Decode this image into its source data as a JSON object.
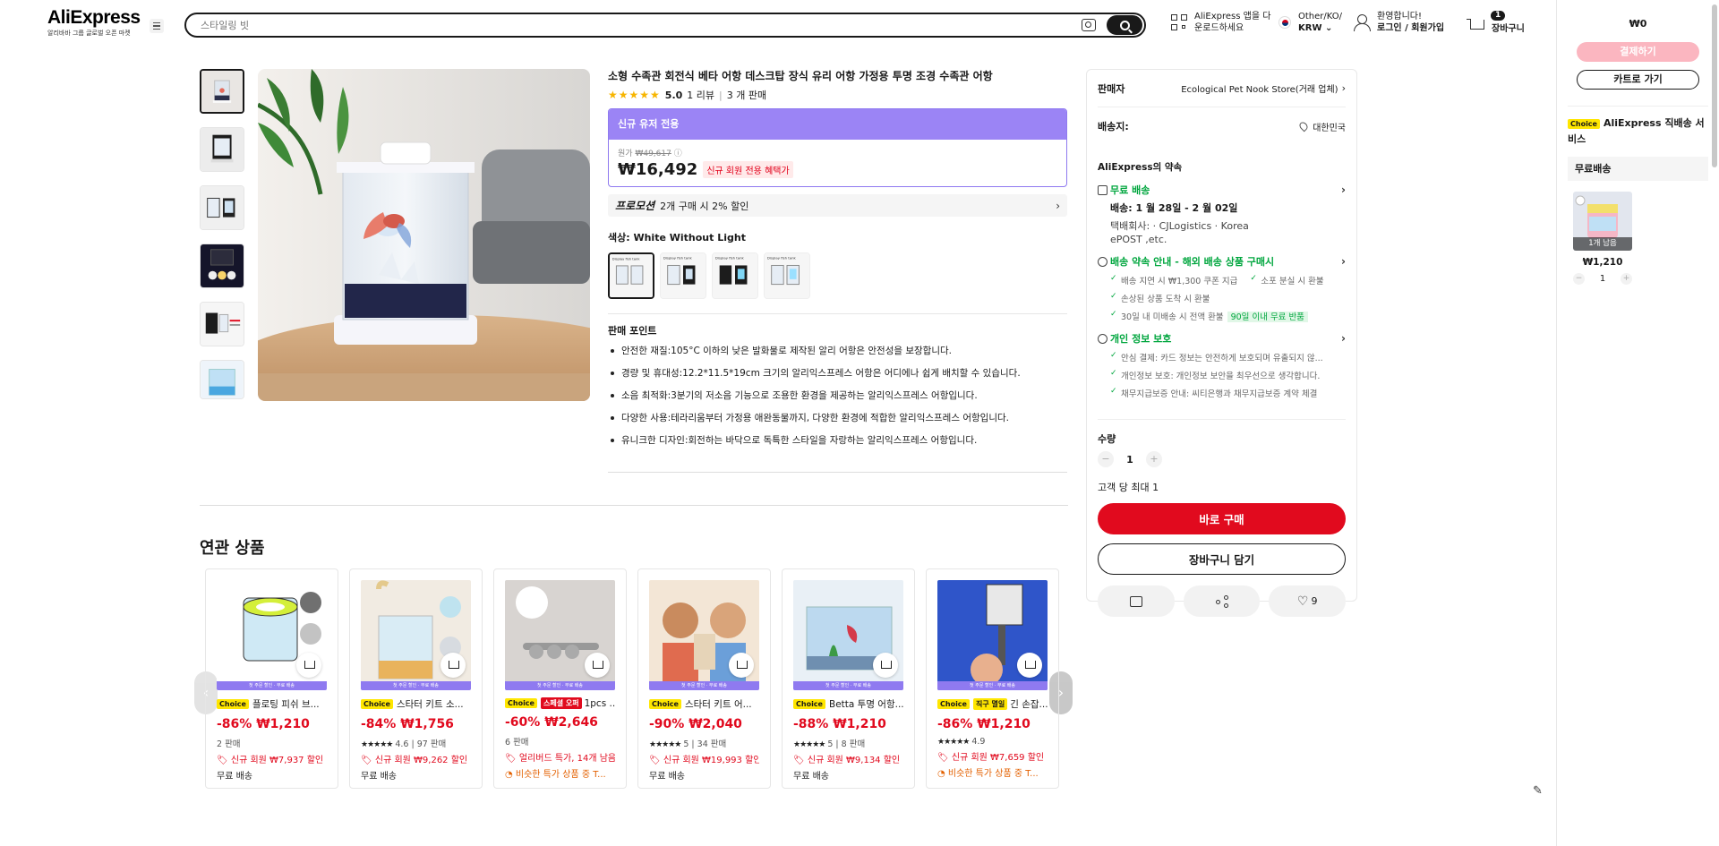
{
  "header": {
    "logo": "AliExpress",
    "logo_sub": "알리바바 그룹 글로벌 오픈 마켓",
    "search_placeholder": "스타일링 빗",
    "app_line1": "AliExpress 앱을 다",
    "app_line2": "운로드하세요",
    "locale_line1": "Other/KO/",
    "locale_line2": "KRW",
    "account_line1": "환영합니다!",
    "account_line2": "로그인 / 회원가입",
    "cart_count": "1",
    "cart_label": "장바구니"
  },
  "product": {
    "title": "소형 수족관 회전식 베타 어항 데스크탑 장식 유리 어항 가정용 투명 조경 수족관 어항",
    "stars": "★★★★★",
    "rating": "5.0",
    "reviews": "1 리뷰",
    "sold": "3 개 판매",
    "promo_header": "신규 유저 전용",
    "original_label": "원가",
    "original_price": "₩49,617",
    "price": "₩16,492",
    "price_tag": "신규 회원 전용 혜택가",
    "promotion_label": "프로모션",
    "promotion_text": "2개 구매 시 2% 할인",
    "color_label": "색상: White Without Light",
    "points_title": "판매 포인트",
    "points": [
      "안전한 재질:105°C 이하의 낮은 발화물로 제작된 알리 어항은 안전성을 보장합니다.",
      "경량 및 휴대성:12.2*11.5*19cm 크기의 알리익스프레스 어항은 어디에나 쉽게 배치할 수 있습니다.",
      "소음 최적화:3분기의 저소음 기능으로 조용한 환경을 제공하는 알리익스프레스 어항입니다.",
      "다양한 사용:테라리움부터 가정용 애완동물까지, 다양한 환경에 적합한 알리익스프레스 어항입니다.",
      "유니크한 디자인:회전하는 바닥으로 독특한 스타일을 자랑하는 알리익스프레스 어항입니다."
    ]
  },
  "panel": {
    "seller_label": "판매자",
    "seller_name": "Ecological Pet Nook Store(거래 업체)",
    "ship_to_label": "배송지:",
    "ship_to": "대한민국",
    "promise_title": "AliExpress의 약속",
    "free_shipping": "무료 배송",
    "delivery": "배송: 1 월 28일 - 2 월 02일",
    "carrier_line1": "택배회사: · CJLogistics · Korea",
    "carrier_line2": "ePOST ,etc.",
    "guarantee_title": "배송 약속 안내 - 해외 배송 상품 구매시",
    "guarantee_1": "배송 지연 시 ₩1,300 쿠폰 지급",
    "guarantee_2": "소포 분실 시 환불",
    "guarantee_3": "손상된 상품 도착 시 환불",
    "guarantee_4": "30일 내 미배송 시 전액 환불",
    "guarantee_tag": "90일 이내 무료 반품",
    "privacy_title": "개인 정보 보호",
    "privacy_1": "안심 결제: 카드 정보는 안전하게 보호되며 유출되지 않...",
    "privacy_2": "개인정보 보호: 개인정보 보안을 최우선으로 생각합니다.",
    "privacy_3": "채무지급보증 안내: 씨티은행과 채무지급보증 계약 체결",
    "qty_label": "수량",
    "qty_minus": "−",
    "qty_value": "1",
    "qty_plus": "+",
    "max_per_customer": "고객 당 최대 1",
    "buy_now": "바로 구매",
    "add_to_cart": "장바구니 담기",
    "wish_count": "9"
  },
  "related": {
    "title": "연관 상품",
    "cards": [
      {
        "name": "플로팅 피쉬 브...",
        "chip": "",
        "price": "-86% ₩1,210",
        "meta": "2 판매",
        "promo": "신규 회원 ₩7,937 할인",
        "promo_type": "red",
        "ship": "무료 배송",
        "img": "#1b1b1b"
      },
      {
        "name": "스타터 키트 소...",
        "chip": "",
        "price": "-84% ₩1,756",
        "meta": "4.6 | 97 판매",
        "stars": "★★★★★",
        "promo": "신규 회원 ₩9,262 할인",
        "promo_type": "red",
        "ship": "무료 배송",
        "img": "#d9cfc2"
      },
      {
        "name": "1pcs ...",
        "chip": "스페셜 오퍼",
        "chip_type": "red",
        "price": "-60% ₩2,646",
        "meta": "6 판매",
        "promo": "얼리버드 특가, 14개 남음",
        "promo_type": "red",
        "ship2": "비슷한 특가 상품 중 T...",
        "img": "#b9b5b2"
      },
      {
        "name": "스타터 키트 어...",
        "chip": "",
        "price": "-90% ₩2,040",
        "meta": "5 | 34 판매",
        "stars": "★★★★★",
        "promo": "신규 회원 ₩19,993 할인",
        "promo_type": "red",
        "ship": "무료 배송",
        "img": "#e8d6c0"
      },
      {
        "name": "Betta 투명 어항...",
        "chip": "",
        "price": "-88% ₩1,210",
        "meta": "5 | 8 판매",
        "stars": "★★★★★",
        "promo": "신규 회원 ₩9,134 할인",
        "promo_type": "red",
        "ship": "무료 배송",
        "img": "#a8c7e0"
      },
      {
        "name": "긴 손잡...",
        "chip": "직구 멸일",
        "chip_type": "yel",
        "price": "-86% ₩1,210",
        "meta": "4.9",
        "stars": "★★★★★",
        "promo": "신규 회원 ₩7,659 할인",
        "promo_type": "red",
        "ship2": "비슷한 특가 상품 중 T...",
        "img": "#3257c9"
      }
    ],
    "choice_label": "Choice",
    "strip_text": "첫 주문 할인 · 무료 배송"
  },
  "sidebar": {
    "total": "₩0",
    "pay": "결제하기",
    "go_cart": "카트로 가기",
    "choice_label": "Choice",
    "service": "AliExpress 직배송 서비스",
    "free": "무료배송",
    "left": "1개 남음",
    "price": "₩1,210",
    "qty": "1"
  }
}
